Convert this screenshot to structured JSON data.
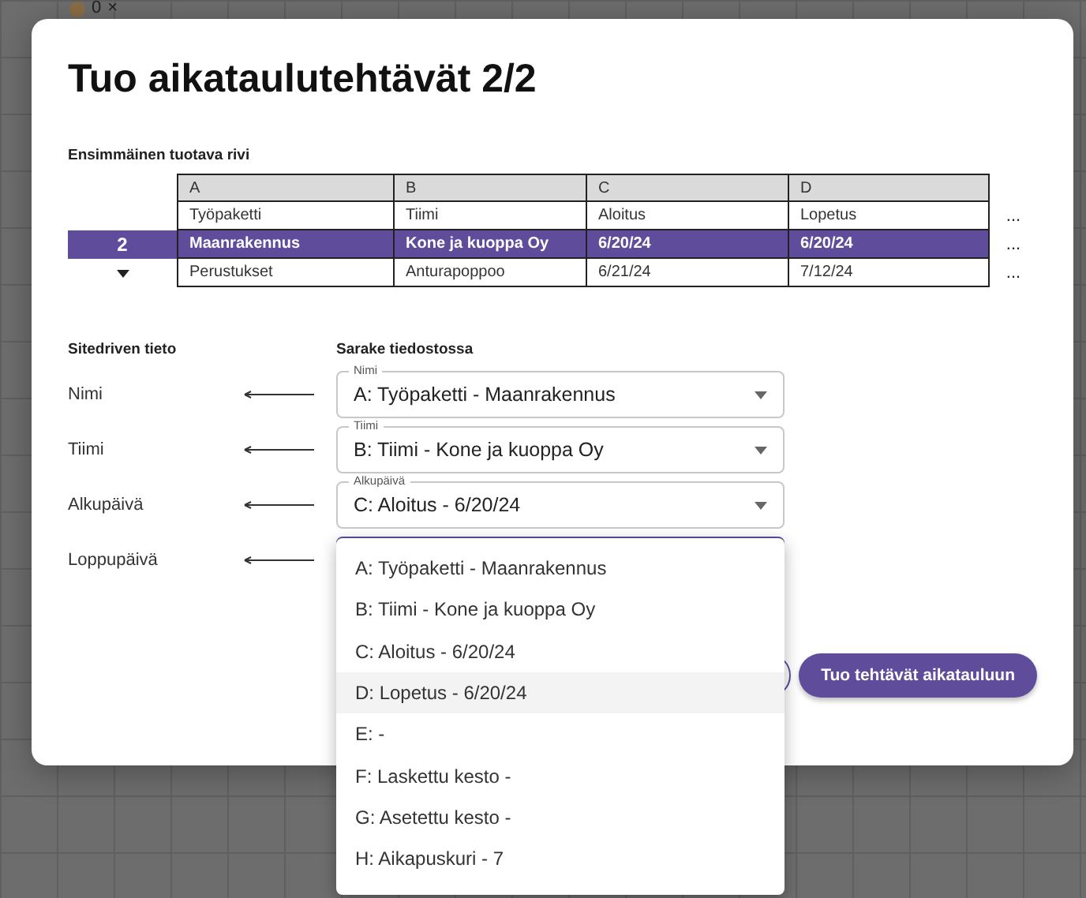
{
  "background": {
    "counter": "0",
    "close": "×"
  },
  "title": "Tuo aikataulutehtävät 2/2",
  "table": {
    "label": "Ensimmäinen tuotava rivi",
    "columns": [
      "A",
      "B",
      "C",
      "D"
    ],
    "more": "...",
    "rows": [
      {
        "selected": false,
        "cells": [
          "Työpaketti",
          "Tiimi",
          "Aloitus",
          "Lopetus"
        ]
      },
      {
        "selected": true,
        "number": "2",
        "cells": [
          "Maanrakennus",
          "Kone ja kuoppa Oy",
          "6/20/24",
          "6/20/24"
        ]
      },
      {
        "selected": false,
        "cells": [
          "Perustukset",
          "Anturapoppoo",
          "6/21/24",
          "7/12/24"
        ]
      }
    ]
  },
  "mapping": {
    "left_heading": "Sitedriven tieto",
    "right_heading": "Sarake tiedostossa",
    "rows": [
      {
        "name": "Nimi",
        "open": false,
        "field_label": "Nimi",
        "value": "A: Työpaketti - Maanrakennus"
      },
      {
        "name": "Tiimi",
        "open": false,
        "field_label": "Tiimi",
        "value": "B: Tiimi - Kone ja kuoppa Oy"
      },
      {
        "name": "Alkupäivä",
        "open": false,
        "field_label": "Alkupäivä",
        "value": "C: Aloitus - 6/20/24"
      },
      {
        "name": "Loppupäivä",
        "open": true
      }
    ]
  },
  "menu": [
    {
      "label": "A: Työpaketti - Maanrakennus",
      "selected": false
    },
    {
      "label": "B: Tiimi - Kone ja kuoppa Oy",
      "selected": false
    },
    {
      "label": "C: Aloitus - 6/20/24",
      "selected": false
    },
    {
      "label": "D: Lopetus - 6/20/24",
      "selected": true
    },
    {
      "label": "E: -",
      "selected": false
    },
    {
      "label": "F: Laskettu kesto -",
      "selected": false
    },
    {
      "label": "G: Asetettu kesto -",
      "selected": false
    },
    {
      "label": "H: Aikapuskuri - 7",
      "selected": false
    }
  ],
  "submit": "Tuo tehtävät aikatauluun"
}
